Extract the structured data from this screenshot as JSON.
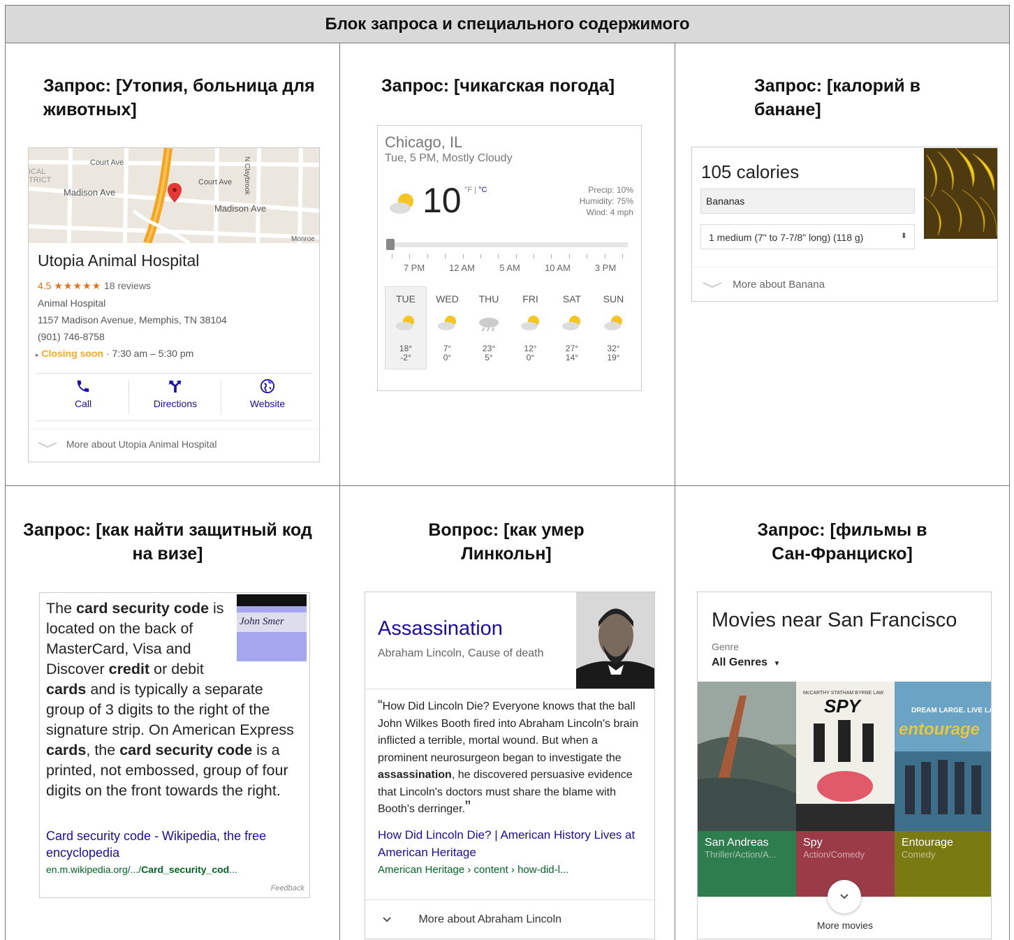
{
  "header": "Блок запроса и специального содержимого",
  "queries": {
    "q1": "Запрос: [Утопия, больница для животных]",
    "q2": "Запрос: [чикагская погода]",
    "q3": "Запрос: [калорий в банане]",
    "q4": "Запрос: [как найти защитный код на визе]",
    "q5": "Вопрос: [как умер Линкольн]",
    "q6": "Запрос: [фильмы в Сан-Франциско]"
  },
  "hospital": {
    "map_labels": [
      "Court Ave",
      "Court Ave",
      "Madison Ave",
      "Madison Ave",
      "N Claybrook",
      "ICAL",
      "TRICT",
      "Monroe"
    ],
    "name": "Utopia Animal Hospital",
    "rating": "4.5",
    "stars": "★★★★★",
    "reviews": "18 reviews",
    "category": "Animal Hospital",
    "address": "1157 Madison Avenue, Memphis, TN 38104",
    "phone": "(901) 746-8758",
    "closing": "Closing soon",
    "hours": "· 7:30 am – 5:30 pm",
    "actions": {
      "call": "Call",
      "directions": "Directions",
      "website": "Website"
    },
    "more": "More about Utopia Animal Hospital"
  },
  "weather": {
    "city": "Chicago, IL",
    "condition": "Tue, 5 PM, Mostly Cloudy",
    "temp": "10",
    "unit_f": "°F",
    "unit_sep": " | ",
    "unit_c": "°C",
    "precip": "Precip: 10%",
    "humidity": "Humidity: 75%",
    "wind": "Wind: 4 mph",
    "time_labels": [
      "7 PM",
      "12 AM",
      "5 AM",
      "10 AM",
      "3 PM"
    ],
    "days": [
      {
        "name": "TUE",
        "hi": "18°",
        "lo": "-2°"
      },
      {
        "name": "WED",
        "hi": "7°",
        "lo": "0°"
      },
      {
        "name": "THU",
        "hi": "23°",
        "lo": "5°"
      },
      {
        "name": "FRI",
        "hi": "12°",
        "lo": "0°"
      },
      {
        "name": "SAT",
        "hi": "27°",
        "lo": "14°"
      },
      {
        "name": "SUN",
        "hi": "32°",
        "lo": "19°"
      }
    ]
  },
  "banana": {
    "calories": "105 calories",
    "food": "Bananas",
    "serving": "1 medium (7\" to 7-7/8\" long) (118 g)",
    "more": "More about Banana"
  },
  "security": {
    "p1": "The ",
    "b1": "card security code",
    "p2": " is located on the back of MasterCard, Visa and Discover ",
    "b2": "credit",
    "p3": " or debit ",
    "b3": "cards",
    "p4": " and is typically a separate group of 3 digits to the right of the signature strip. On American Express ",
    "b4": "cards",
    "p5": ", the ",
    "b5": "card security code",
    "p6": " is a printed, not embossed, group of four digits on the front towards the right.",
    "signature": "John Smer",
    "link": "Card security code - Wikipedia, the free encyclopedia",
    "url_prefix": "en.m.wikipedia.org/.../",
    "url_bold": "Card_security_cod",
    "url_suffix": "...",
    "feedback": "Feedback"
  },
  "lincoln": {
    "title": "Assassination",
    "subtitle": "Abraham Lincoln, Cause of death",
    "q_open": "“",
    "quote1": "How Did Lincoln Die? Everyone knows that the ball John Wilkes Booth fired into Abraham Lincoln's brain inflicted a terrible, mortal wound. But when a prominent neurosurgeon began to investigate the ",
    "quote_bold": "assassination",
    "quote2": ", he discovered persuasive evidence that Lincoln's doctors must share the blame with Booth's derringer.",
    "q_close": "”",
    "link": "How Did Lincoln Die? | American History Lives at American Heritage",
    "url": "American Heritage › content › how-did-l...",
    "more": "More about Abraham Lincoln"
  },
  "movies": {
    "title": "Movies near San Francisco",
    "genre_label": "Genre",
    "genre_value": "All Genres",
    "poster_text": {
      "spy_cast": "McCARTHY  STATHAM  BYRNE  LAW",
      "spy": "SPY",
      "ent_tag": "DREAM LARGE. LIVE LARGER.",
      "ent": "entourage"
    },
    "items": [
      {
        "title": "San Andreas",
        "genre": "Thriller/Action/A..."
      },
      {
        "title": "Spy",
        "genre": "Action/Comedy"
      },
      {
        "title": "Entourage",
        "genre": "Comedy"
      }
    ],
    "tile_colors": [
      "#2e7d4f",
      "#9c3b48",
      "#7a7a12"
    ],
    "more": "More movies"
  }
}
